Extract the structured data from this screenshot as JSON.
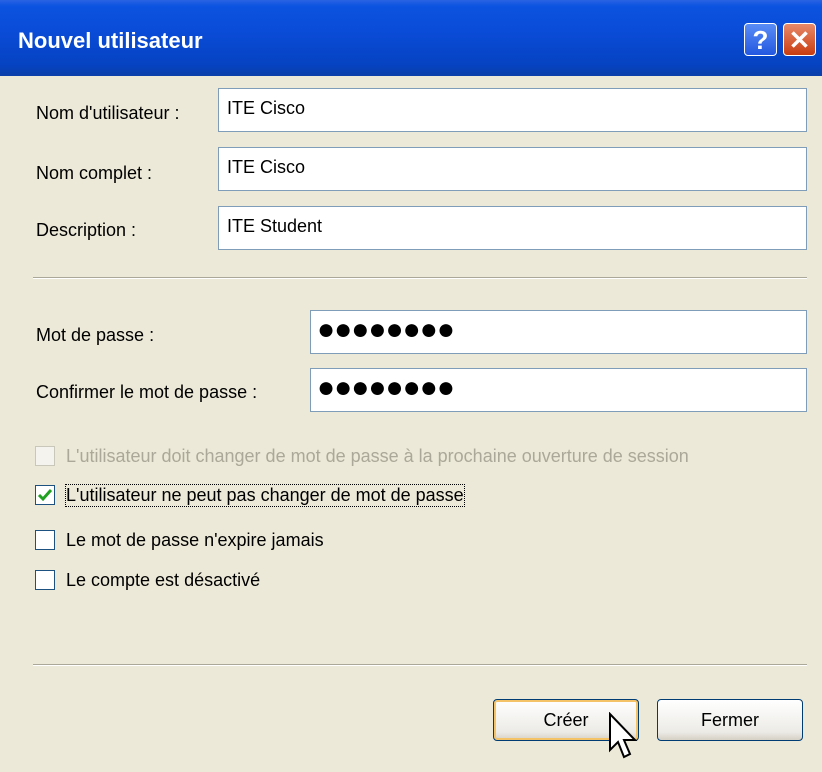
{
  "window": {
    "title": "Nouvel utilisateur",
    "help_glyph": "?",
    "close_glyph": "✕"
  },
  "form": {
    "username_label": "Nom d'utilisateur :",
    "username_value": "ITE Cisco",
    "fullname_label": "Nom complet :",
    "fullname_value": "ITE Cisco",
    "description_label": "Description :",
    "description_value": "ITE Student",
    "password_label": "Mot de passe :",
    "password_value": "●●●●●●●●",
    "confirm_label": "Confirmer le mot de passe :",
    "confirm_value": "●●●●●●●●"
  },
  "options": [
    {
      "label": "L'utilisateur doit changer de mot de passe à la prochaine ouverture de session",
      "checked": false,
      "disabled": true
    },
    {
      "label": "L'utilisateur ne peut pas changer de mot de passe",
      "checked": true,
      "disabled": false
    },
    {
      "label": "Le mot de passe n'expire jamais",
      "checked": false,
      "disabled": false
    },
    {
      "label": "Le compte est désactivé",
      "checked": false,
      "disabled": false
    }
  ],
  "buttons": {
    "create": "Créer",
    "close": "Fermer"
  },
  "colors": {
    "titlebar": "#0A4BD6",
    "dialog": "#ECE9D8",
    "check": "#21A121"
  },
  "cursor": "arrow-pointer-icon"
}
